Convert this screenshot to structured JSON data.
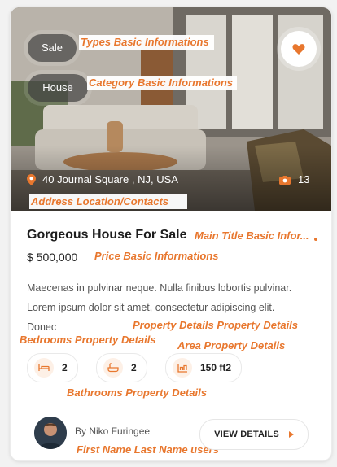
{
  "listing": {
    "type_tag": "Sale",
    "category_tag": "House",
    "address": "40 Journal Square , NJ, USA",
    "photo_count": "13",
    "title": "Gorgeous House For Sale",
    "price": "$ 500,000",
    "description": "Maecenas in pulvinar neque. Nulla finibus lobortis pulvinar. Lorem ipsum dolor sit amet, consectetur adipiscing elit. Donec",
    "features": {
      "bedrooms": "2",
      "bathrooms": "2",
      "area": "150 ft2"
    },
    "author": "By Niko Furingee",
    "details_button": "VIEW DETAILS"
  },
  "annotations": {
    "types": "Types Basic Informations",
    "category": "Category Basic Informations",
    "address": "Address Location/Contacts",
    "main_title": "Main Title Basic Infor...",
    "price": "Price Basic Informations",
    "property_details": "Property Details Property Details",
    "bedrooms": "Bedrooms Property Details",
    "area": "Area Property Details",
    "bathrooms": "Bathrooms Property Details",
    "user_name": "First Name Last Name users"
  },
  "colors": {
    "accent": "#e8772e",
    "text_dark": "#1d1d1d",
    "text_muted": "#555555"
  },
  "icons": {
    "favorite": "heart-icon",
    "address": "location-pin-icon",
    "photos": "camera-icon",
    "bedrooms": "bed-icon",
    "bathrooms": "bathtub-icon",
    "area": "area-icon",
    "details_button": "triangle-right-icon"
  }
}
